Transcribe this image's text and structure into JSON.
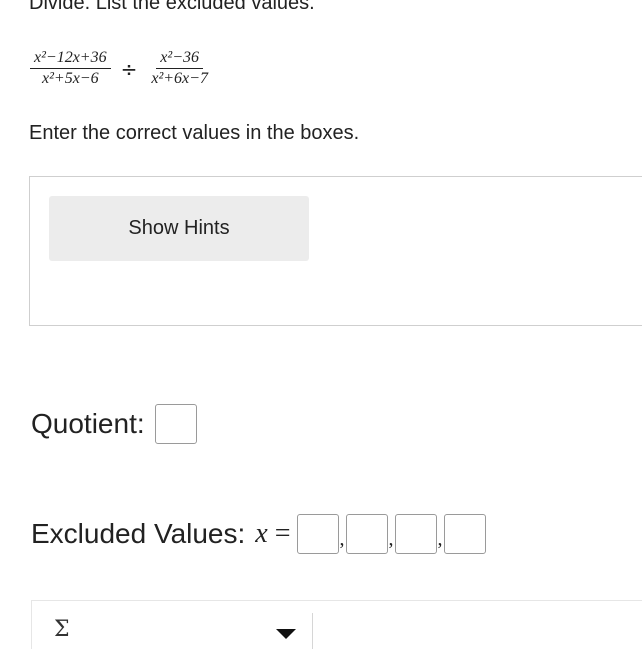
{
  "problem": {
    "instruction": "Divide. List the excluded values.",
    "fraction1": {
      "numerator": "x²−12x+36",
      "denominator": "x²+5x−6"
    },
    "operator": "÷",
    "fraction2": {
      "numerator": "x²−36",
      "denominator": "x²+6x−7"
    }
  },
  "instructions": {
    "enter": "Enter the correct values in the boxes."
  },
  "hints": {
    "button_label": "Show Hints"
  },
  "quotient": {
    "label": "Quotient:",
    "value": ""
  },
  "excluded": {
    "label": "Excluded Values:",
    "variable": "x",
    "equals": "=",
    "separator": ",",
    "values": [
      "",
      "",
      "",
      ""
    ]
  },
  "toolbar": {
    "symbol_icon": "sigma-icon",
    "symbol_glyph": "Σ",
    "dropdown_icon": "caret-down-icon"
  }
}
